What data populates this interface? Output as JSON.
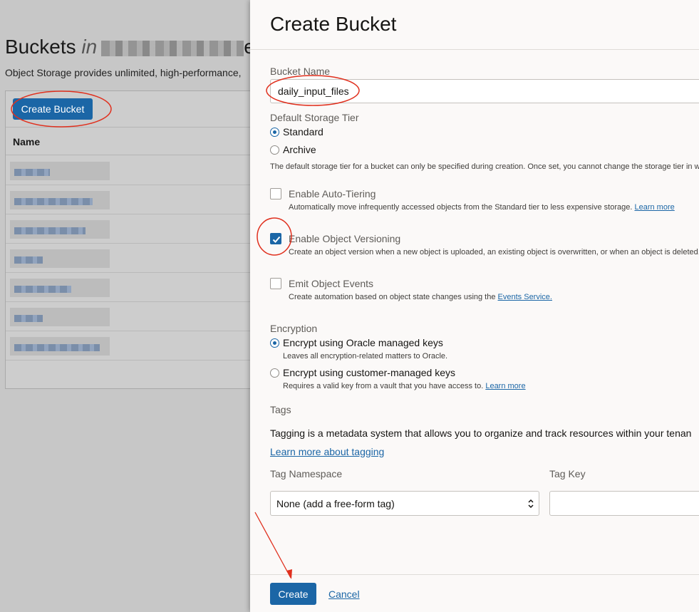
{
  "background": {
    "title_prefix": "Buckets",
    "title_in": "in",
    "title_suffix": "e",
    "description": "Object Storage provides unlimited, high-performance,",
    "create_button": "Create Bucket",
    "table_header_name": "Name"
  },
  "drawer": {
    "title": "Create Bucket",
    "bucket_name": {
      "label": "Bucket Name",
      "value": "daily_input_files"
    },
    "storage_tier": {
      "label": "Default Storage Tier",
      "options": [
        {
          "label": "Standard",
          "selected": true
        },
        {
          "label": "Archive",
          "selected": false
        }
      ],
      "help": "The default storage tier for a bucket can only be specified during creation. Once set, you cannot change the storage tier in w"
    },
    "auto_tiering": {
      "label": "Enable Auto-Tiering",
      "checked": false,
      "help": "Automatically move infrequently accessed objects from the Standard tier to less expensive storage.",
      "link": "Learn more"
    },
    "versioning": {
      "label": "Enable Object Versioning",
      "checked": true,
      "help": "Create an object version when a new object is uploaded, an existing object is overwritten, or when an object is deleted."
    },
    "object_events": {
      "label": "Emit Object Events",
      "checked": false,
      "help": "Create automation based on object state changes using the",
      "link": "Events Service."
    },
    "encryption": {
      "label": "Encryption",
      "oracle": {
        "label": "Encrypt using Oracle managed keys",
        "selected": true,
        "help": "Leaves all encryption-related matters to Oracle."
      },
      "customer": {
        "label": "Encrypt using customer-managed keys",
        "selected": false,
        "help": "Requires a valid key from a vault that you have access to.",
        "link": "Learn more"
      }
    },
    "tags": {
      "label": "Tags",
      "description": "Tagging is a metadata system that allows you to organize and track resources within your tenan",
      "learn_more": "Learn more about tagging",
      "namespace_label": "Tag Namespace",
      "namespace_value": "None (add a free-form tag)",
      "key_label": "Tag Key",
      "key_value": ""
    },
    "footer": {
      "create": "Create",
      "cancel": "Cancel"
    }
  },
  "colors": {
    "accent": "#1b66a6",
    "annotation": "#e0301e"
  }
}
